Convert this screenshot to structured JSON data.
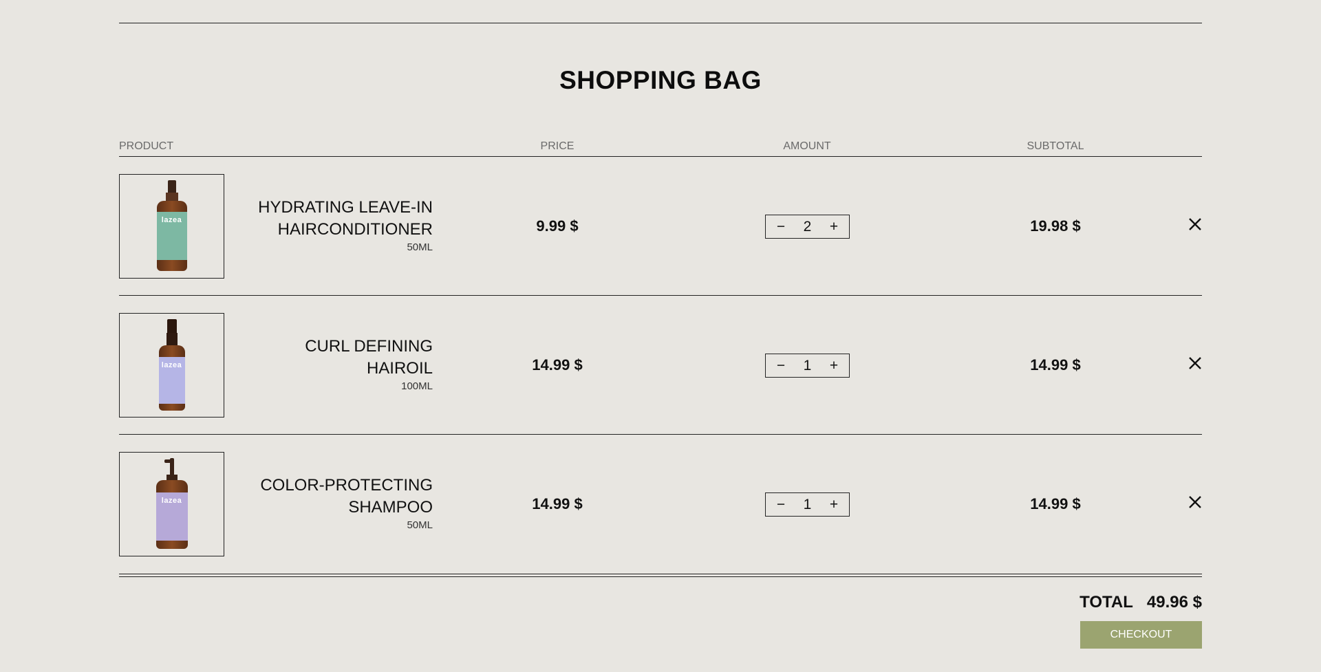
{
  "page": {
    "title": "SHOPPING BAG"
  },
  "table": {
    "headers": {
      "product": "PRODUCT",
      "price": "PRICE",
      "amount": "AMOUNT",
      "subtotal": "SUBTOTAL"
    }
  },
  "items": [
    {
      "name_line1": "HYDRATING LEAVE-IN",
      "name_line2": "HAIRCONDITIONER",
      "size": "50ML",
      "price": "9.99 $",
      "qty": "2",
      "subtotal": "19.98 $",
      "brand": "lazea",
      "label_color": "#7db8a3"
    },
    {
      "name_line1": "CURL DEFINING",
      "name_line2": "HAIROIL",
      "size": "100ML",
      "price": "14.99 $",
      "qty": "1",
      "subtotal": "14.99 $",
      "brand": "lazea",
      "label_color": "#b5b5e6"
    },
    {
      "name_line1": "COLOR-PROTECTING",
      "name_line2": "SHAMPOO",
      "size": "50ML",
      "price": "14.99 $",
      "qty": "1",
      "subtotal": "14.99 $",
      "brand": "lazea",
      "label_color": "#b6a9d8"
    }
  ],
  "stepper": {
    "minus": "−",
    "plus": "+"
  },
  "summary": {
    "total_label": "TOTAL",
    "total_value": "49.96 $",
    "checkout_label": "CHECKOUT"
  },
  "colors": {
    "background": "#e8e6e1",
    "checkout": "#9ba470",
    "text": "#111111"
  }
}
